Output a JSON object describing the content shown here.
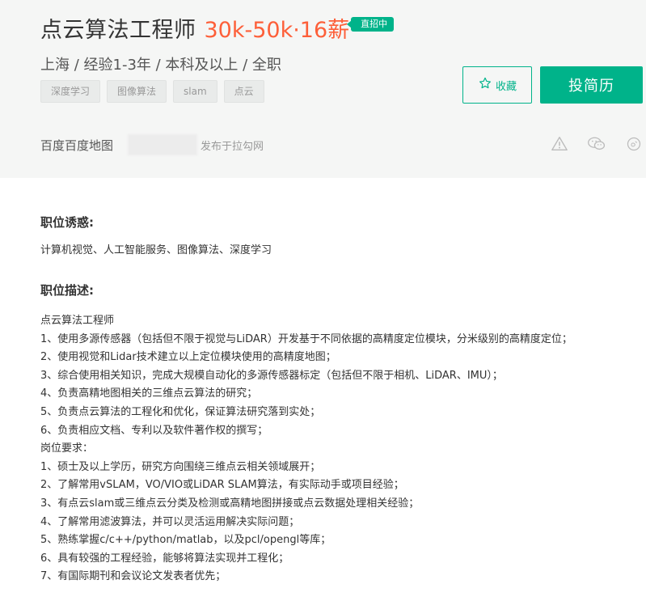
{
  "job": {
    "title": "点云算法工程师",
    "salary": "30k-50k·16薪",
    "badge": "直招中",
    "meta": "上海 / 经验1-3年 / 本科及以上 / 全职",
    "tags": [
      "深度学习",
      "图像算法",
      "slam",
      "点云"
    ]
  },
  "actions": {
    "favorite_label": "收藏",
    "apply_label": "投简历"
  },
  "company": {
    "name": "百度百度地图",
    "posted": "发布于拉勾网"
  },
  "sections": {
    "lure_title": "职位诱惑:",
    "lure_text": "计算机视觉、人工智能服务、图像算法、深度学习",
    "desc_title": "职位描述:",
    "desc_lines": [
      "点云算法工程师",
      "1、使用多源传感器（包括但不限于视觉与LiDAR）开发基于不同依据的高精度定位模块，分米级别的高精度定位；",
      "2、使用视觉和Lidar技术建立以上定位模块使用的高精度地图；",
      "3、综合使用相关知识，完成大规模自动化的多源传感器标定（包括但不限于相机、LiDAR、IMU）；",
      "4、负责高精地图相关的三维点云算法的研究；",
      "5、负责点云算法的工程化和优化，保证算法研究落到实处；",
      "6、负责相应文档、专利以及软件著作权的撰写；",
      "岗位要求：",
      "1、硕士及以上学历，研究方向围绕三维点云相关领域展开；",
      "2、了解常用vSLAM，VO/VIO或LiDAR SLAM算法，有实际动手或项目经验；",
      "3、有点云slam或三维点云分类及检测或高精地图拼接或点云数据处理相关经验；",
      "4、了解常用滤波算法，并可以灵活运用解决实际问题；",
      "5、熟练掌握c/c++/python/matlab，以及pcl/opengl等库；",
      "6、具有较强的工程经验，能够将算法实现并工程化；",
      "7、有国际期刊和会议论文发表者优先；"
    ]
  },
  "colors": {
    "accent": "#00b38a",
    "salary": "#fd5f39"
  },
  "icons": [
    "star-icon",
    "warning-icon",
    "wechat-icon",
    "weibo-icon"
  ]
}
